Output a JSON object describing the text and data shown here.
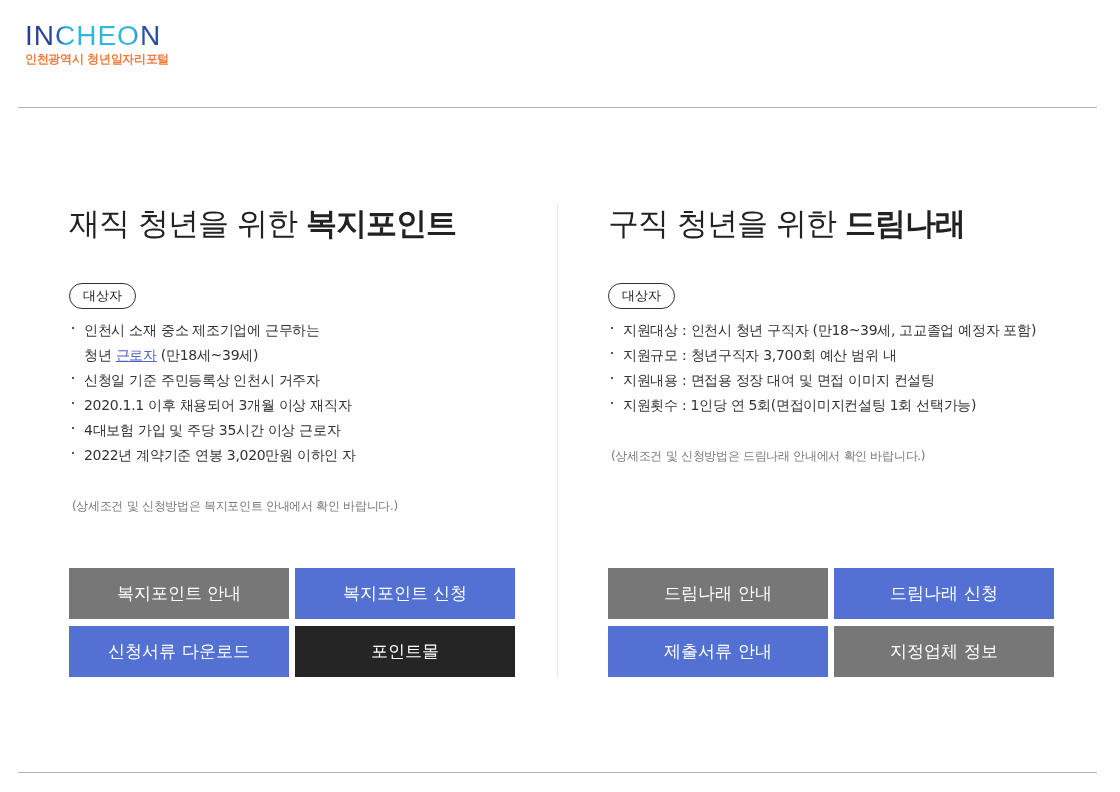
{
  "header": {
    "logo": {
      "wordmark": "INCHEON",
      "tagline": "인천광역시 청년일자리포털"
    }
  },
  "sections": [
    {
      "title": "재직 청년을 위한 **복지포인트**",
      "badge": "대상자",
      "items": [
        {
          "text": "인천시 소재 중소 제조기업에 근무하는\n청년 ",
          "link": "근로자",
          "after": " (만18세~39세)"
        },
        {
          "text": "신청일 기준 주민등록상 인천시 거주자"
        },
        {
          "text": "2020.1.1 이후 채용되어 3개월 이상 재직자"
        },
        {
          "text": "4대보험 가입 및 주당 35시간 이상 근로자"
        },
        {
          "text": "2022년 계약기준 연봉 3,020만원 이하인 자"
        }
      ],
      "note": "(상세조건 및 신청방법은 복지포인트 안내에서 확인 바랍니다.)",
      "buttons": [
        {
          "label": "복지포인트 안내",
          "color": "#777777"
        },
        {
          "label": "복지포인트 신청",
          "color": "#5271d3"
        },
        {
          "label": "신청서류 다운로드",
          "color": "#5271d3"
        },
        {
          "label": "포인트몰",
          "color": "#252525"
        }
      ]
    },
    {
      "title": "구직 청년을 위한 **드림나래**",
      "badge": "대상자",
      "items": [
        {
          "text": "지원대상 : 인천시 청년 구직자 (만18~39세, 고교졸업 예정자 포함)"
        },
        {
          "text": "지원규모 : 청년구직자 3,700회 예산 범위 내"
        },
        {
          "text": "지원내용 : 면접용 정장 대여 및 면접 이미지 컨설팅"
        },
        {
          "text": "지원횟수 : 1인당 연 5회(면접이미지컨설팅 1회 선택가능)"
        }
      ],
      "note": "(상세조건 및 신청방법은 드림나래 안내에서 확인 바랍니다.)",
      "buttons": [
        {
          "label": "드림나래 안내",
          "color": "#777777"
        },
        {
          "label": "드림나래 신청",
          "color": "#5271d3"
        },
        {
          "label": "제출서류 안내",
          "color": "#5271d3"
        },
        {
          "label": "지정업체 정보",
          "color": "#777777"
        }
      ]
    }
  ]
}
